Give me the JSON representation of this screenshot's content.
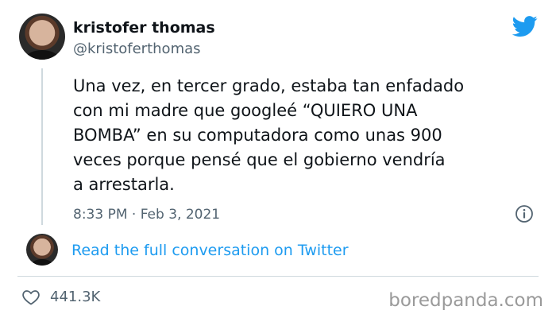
{
  "tweet": {
    "author_name": "kristofer thomas",
    "author_handle": "@kristoferthomas",
    "text_lines": [
      "Una vez, en tercer grado, estaba tan enfadado",
      "con mi madre que googleé “QUIERO UNA",
      "BOMBA” en su computadora como unas 900",
      "veces porque pensé que el gobierno vendría",
      "a arrestarla."
    ],
    "timestamp": "8:33 PM · Feb 3, 2021",
    "read_link": "Read the full conversation on Twitter",
    "likes": "441.3K"
  },
  "watermark": "boredpanda.com",
  "icons": {
    "logo": "twitter-bird-icon",
    "info": "info-icon",
    "like": "heart-icon"
  },
  "colors": {
    "twitter_blue": "#1d9bf0",
    "text": "#0f1419",
    "secondary_text": "#536471",
    "divider": "#cfd9de"
  }
}
